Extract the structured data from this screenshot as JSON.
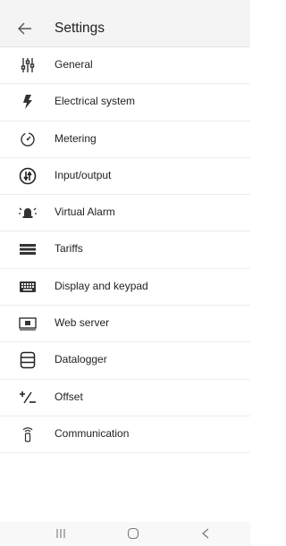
{
  "header": {
    "title": "Settings",
    "back_icon": "arrow-left-icon"
  },
  "items": [
    {
      "label": "General",
      "icon": "sliders-icon"
    },
    {
      "label": "Electrical system",
      "icon": "lightning-icon"
    },
    {
      "label": "Metering",
      "icon": "meter-gauge-icon"
    },
    {
      "label": "Input/output",
      "icon": "input-output-icon"
    },
    {
      "label": "Virtual Alarm",
      "icon": "alarm-bell-icon"
    },
    {
      "label": "Tariffs",
      "icon": "tariffs-list-icon"
    },
    {
      "label": "Display and keypad",
      "icon": "keyboard-icon"
    },
    {
      "label": "Web server",
      "icon": "web-server-icon"
    },
    {
      "label": "Datalogger",
      "icon": "database-icon"
    },
    {
      "label": "Offset",
      "icon": "plus-minus-icon"
    },
    {
      "label": "Communication",
      "icon": "antenna-icon"
    }
  ],
  "navbar": {
    "recent_icon": "recent-apps-icon",
    "home_icon": "home-icon",
    "back_icon": "nav-back-icon"
  }
}
